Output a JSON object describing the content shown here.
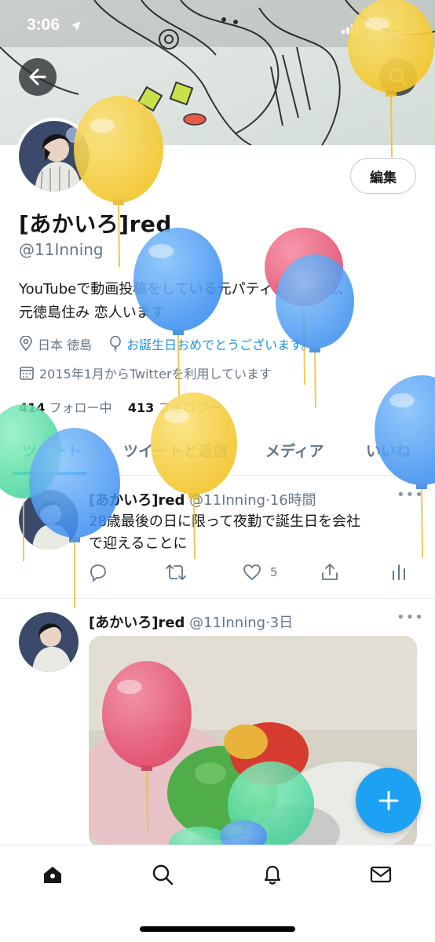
{
  "status_bar": {
    "time": "3:06",
    "network": "4G"
  },
  "profile": {
    "edit_label": "編集",
    "display_name": "[あかいろ]red",
    "handle": "@11Inning",
    "bio_line1": "YouTubeで動画投稿をしている元パティシエ 28歳、",
    "bio_line2": "元徳島住み 恋人います",
    "location": "日本 徳島",
    "birthday_text": "お誕生日おめでとうございます。",
    "joined": "2015年1月からTwitterを利用しています",
    "following_count": "414",
    "following_label": "フォロー中",
    "followers_count": "413",
    "followers_label": "フォロワー"
  },
  "tabs": [
    {
      "label": "ツイート"
    },
    {
      "label": "ツイートと返信"
    },
    {
      "label": "メディア"
    },
    {
      "label": "いいね"
    }
  ],
  "tweets": [
    {
      "name": "[あかいろ]red",
      "handle": "@11Inning",
      "dot": "·",
      "time": "16時間",
      "text_line1": "28歳最後の日に限って夜勤で誕生日を会社",
      "text_line2": "で迎えることに",
      "like_count": "5"
    },
    {
      "name": "[あかいろ]red",
      "handle": "@11Inning",
      "dot": "·",
      "time": "3日"
    }
  ],
  "more_glyph": "•••",
  "icons": {
    "back": "arrow-left-icon",
    "search": "search-icon",
    "location": "location-pin-icon",
    "birthday": "balloon-icon",
    "calendar": "calendar-icon",
    "reply": "reply-icon",
    "retweet": "retweet-icon",
    "like": "heart-icon",
    "share": "share-icon",
    "analytics": "analytics-icon",
    "home": "home-icon",
    "explore": "search-icon",
    "notifications": "bell-icon",
    "messages": "mail-icon",
    "compose": "plus-icon"
  },
  "colors": {
    "accent": "#1da1f2",
    "secondary_text": "#657786",
    "link": "#1b95e0"
  }
}
